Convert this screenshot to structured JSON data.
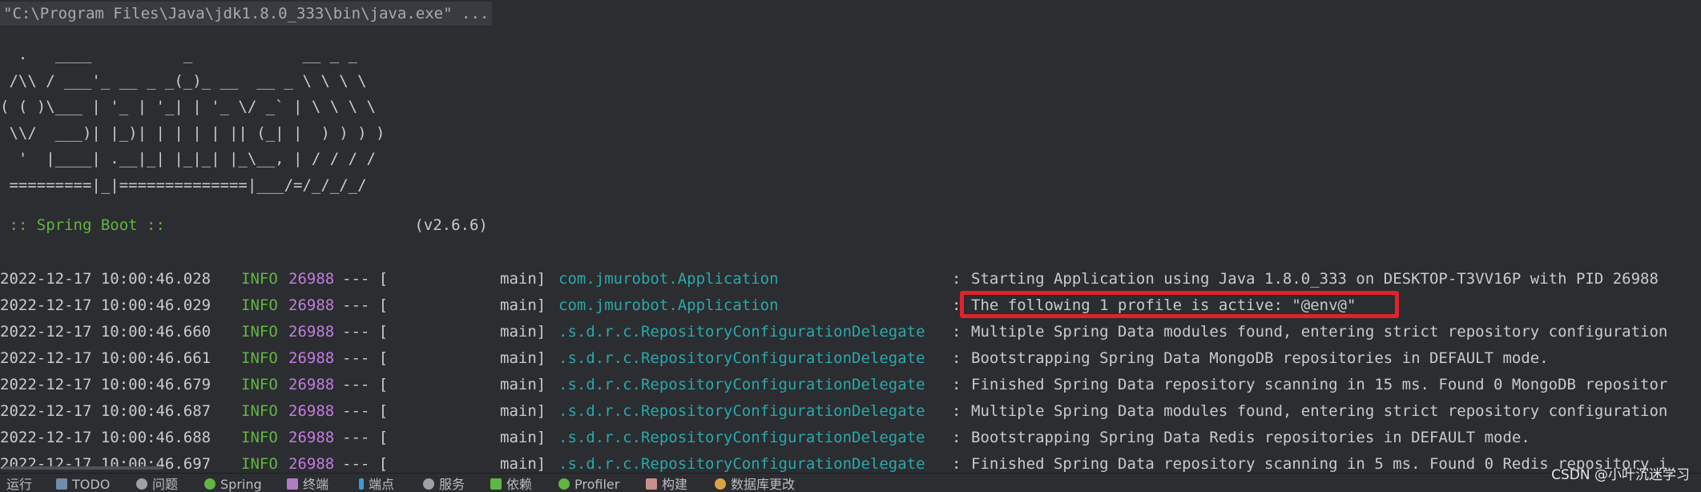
{
  "console": {
    "command": "\"C:\\Program Files\\Java\\jdk1.8.0_333\\bin\\java.exe\" ...",
    "banner": "  .   ____          _            __ _ _\n /\\\\ / ___'_ __ _ _(_)_ __  __ _ \\ \\ \\ \\\n( ( )\\___ | '_ | '_| | '_ \\/ _` | \\ \\ \\ \\\n \\\\/  ___)| |_)| | | | | || (_| |  ) ) ) )\n  '  |____| .__|_| |_|_| |_\\__, | / / / /\n =========|_|==============|___/=/_/_/_/",
    "boot_label": " :: Spring Boot :: ",
    "boot_version": "(v2.6.6)",
    "highlight_color": "#e0232b",
    "logs": [
      {
        "ts": "2022-12-17 10:00:46.028",
        "level": "INFO",
        "pid": "26988",
        "sep": "--- [",
        "thread": "main]",
        "logger": "com.jmurobot.Application",
        "colon": ":",
        "msg": "Starting Application using Java 1.8.0_333 on DESKTOP-T3VV16P with PID 26988"
      },
      {
        "ts": "2022-12-17 10:00:46.029",
        "level": "INFO",
        "pid": "26988",
        "sep": "--- [",
        "thread": "main]",
        "logger": "com.jmurobot.Application",
        "colon": ":",
        "msg": "The following 1 profile is active: \"@env@\""
      },
      {
        "ts": "2022-12-17 10:00:46.660",
        "level": "INFO",
        "pid": "26988",
        "sep": "--- [",
        "thread": "main]",
        "logger": ".s.d.r.c.RepositoryConfigurationDelegate",
        "colon": ":",
        "msg": "Multiple Spring Data modules found, entering strict repository configuration"
      },
      {
        "ts": "2022-12-17 10:00:46.661",
        "level": "INFO",
        "pid": "26988",
        "sep": "--- [",
        "thread": "main]",
        "logger": ".s.d.r.c.RepositoryConfigurationDelegate",
        "colon": ":",
        "msg": "Bootstrapping Spring Data MongoDB repositories in DEFAULT mode."
      },
      {
        "ts": "2022-12-17 10:00:46.679",
        "level": "INFO",
        "pid": "26988",
        "sep": "--- [",
        "thread": "main]",
        "logger": ".s.d.r.c.RepositoryConfigurationDelegate",
        "colon": ":",
        "msg": "Finished Spring Data repository scanning in 15 ms. Found 0 MongoDB repositor"
      },
      {
        "ts": "2022-12-17 10:00:46.687",
        "level": "INFO",
        "pid": "26988",
        "sep": "--- [",
        "thread": "main]",
        "logger": ".s.d.r.c.RepositoryConfigurationDelegate",
        "colon": ":",
        "msg": "Multiple Spring Data modules found, entering strict repository configuration"
      },
      {
        "ts": "2022-12-17 10:00:46.688",
        "level": "INFO",
        "pid": "26988",
        "sep": "--- [",
        "thread": "main]",
        "logger": ".s.d.r.c.RepositoryConfigurationDelegate",
        "colon": ":",
        "msg": "Bootstrapping Spring Data Redis repositories in DEFAULT mode."
      },
      {
        "ts": "2022-12-17 10:00:46.697",
        "level": "INFO",
        "pid": "26988",
        "sep": "--- [",
        "thread": "main]",
        "logger": ".s.d.r.c.RepositoryConfigurationDelegate",
        "colon": ":",
        "msg": "Finished Spring Data repository scanning in 5 ms. Found 0 Redis repository i"
      }
    ]
  },
  "toolbar": {
    "tabs": [
      {
        "label": "运行",
        "icon": "run-icon",
        "color": "#bbbdc1"
      },
      {
        "label": "TODO",
        "icon": "todo-icon",
        "color": "#6f8ea8"
      },
      {
        "label": "问题",
        "icon": "problems-icon",
        "color": "#9da0a8"
      },
      {
        "label": "Spring",
        "icon": "spring-icon",
        "color": "#62b543"
      },
      {
        "label": "终端",
        "icon": "terminal-icon",
        "color": "#b07cc6"
      },
      {
        "label": "端点",
        "icon": "endpoints-icon",
        "color": "#3d9ad1"
      },
      {
        "label": "服务",
        "icon": "services-icon",
        "color": "#9da0a8"
      },
      {
        "label": "依赖",
        "icon": "dependencies-icon",
        "color": "#62b543"
      },
      {
        "label": "Profiler",
        "icon": "profiler-icon",
        "color": "#62b543"
      },
      {
        "label": "构建",
        "icon": "build-icon",
        "color": "#c98d8d"
      },
      {
        "label": "数据库更改",
        "icon": "database-changes-icon",
        "color": "#d9a343"
      }
    ]
  },
  "watermark": {
    "text": "CSDN @小叶沉迷学习"
  }
}
